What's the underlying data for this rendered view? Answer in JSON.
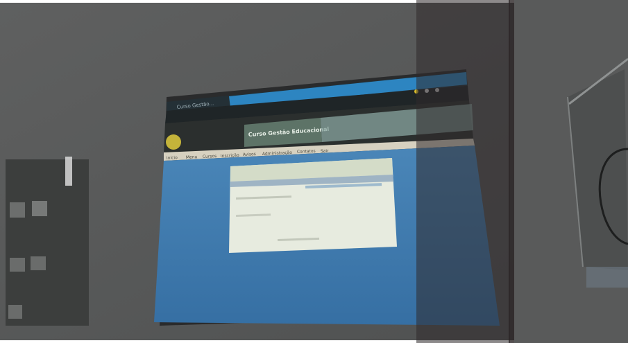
{
  "photo": {
    "colors": {
      "room": "#58595a",
      "room_dark": "#3f4140",
      "frame": "#262728",
      "screen_blue": "#3d7ab0",
      "header_dark": "#2b2f2e",
      "site_banner": "#5d7367",
      "dialog": "#e7ebdf",
      "overlay_strip": "#2f2a2b"
    },
    "projected_page": {
      "browser_tab_title": "Curso Gestão...",
      "site_title": "Curso Gestão Educacional",
      "menu_items": [
        "Início",
        "Menu",
        "Cursos",
        "Inscrição",
        "Avisos",
        "Administração",
        "Contatos",
        "Sair"
      ]
    }
  }
}
